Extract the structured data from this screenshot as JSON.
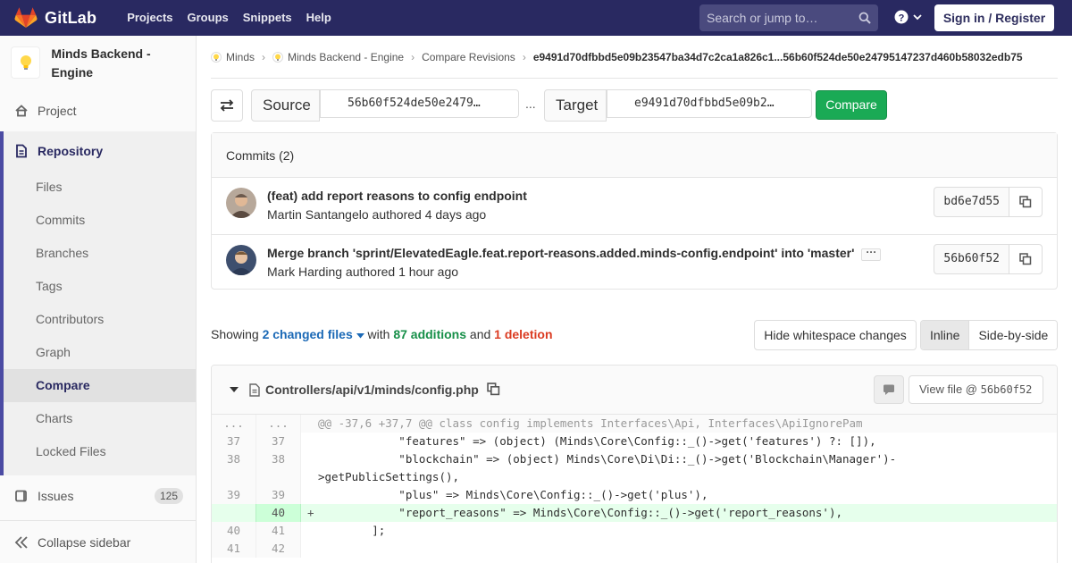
{
  "nav": {
    "brand": "GitLab",
    "links": [
      "Projects",
      "Groups",
      "Snippets",
      "Help"
    ],
    "search_placeholder": "Search or jump to…",
    "signin": "Sign in / Register"
  },
  "sidebar": {
    "project_name": "Minds Backend - Engine",
    "project": "Project",
    "repository": "Repository",
    "sub_items": [
      "Files",
      "Commits",
      "Branches",
      "Tags",
      "Contributors",
      "Graph",
      "Compare",
      "Charts",
      "Locked Files"
    ],
    "active_sub": "Compare",
    "issues": "Issues",
    "issues_count": "125",
    "collapse": "Collapse sidebar"
  },
  "breadcrumb": {
    "items": [
      "Minds",
      "Minds Backend - Engine",
      "Compare Revisions"
    ],
    "current": "e9491d70dfbbd5e09b23547ba34d7c2ca1a826c1...56b60f524de50e24795147237d460b58032edb75"
  },
  "compare": {
    "source_label": "Source",
    "source_value": "56b60f524de50e2479…",
    "ellipsis": "...",
    "target_label": "Target",
    "target_value": "e9491d70dfbbd5e09b2…",
    "button": "Compare"
  },
  "commits": {
    "header": "Commits (2)",
    "items": [
      {
        "title": "(feat) add report reasons to config endpoint",
        "author": "Martin Santangelo",
        "meta": "authored 4 days ago",
        "sha": "bd6e7d55"
      },
      {
        "title": "Merge branch 'sprint/ElevatedEagle.feat.report-reasons.added.minds-config.endpoint' into 'master'",
        "author": "Mark Harding",
        "meta": "authored 1 hour ago",
        "sha": "56b60f52"
      }
    ]
  },
  "summary": {
    "showing": "Showing",
    "changed": "2 changed files",
    "with": "with",
    "additions": "87 additions",
    "and": "and",
    "deletions": "1 deletion",
    "hide_ws": "Hide whitespace changes",
    "inline": "Inline",
    "side_by_side": "Side-by-side"
  },
  "file": {
    "path": "Controllers/api/v1/minds/config.php",
    "view_file": "View file @",
    "view_sha": "56b60f52"
  },
  "diff": [
    {
      "type": "match",
      "old": "...",
      "new": "...",
      "code": "@@ -37,6 +37,7 @@ class config implements Interfaces\\Api, Interfaces\\ApiIgnorePam"
    },
    {
      "type": "ctx",
      "old": "37",
      "new": "37",
      "code": "            \"features\" => (object) (Minds\\Core\\Config::_()->get('features') ?: []),"
    },
    {
      "type": "ctx",
      "old": "38",
      "new": "38",
      "code": "            \"blockchain\" => (object) Minds\\Core\\Di\\Di::_()->get('Blockchain\\Manager')-",
      "cont": ">getPublicSettings(),"
    },
    {
      "type": "ctx",
      "old": "39",
      "new": "39",
      "code": "            \"plus\" => Minds\\Core\\Config::_()->get('plus'),"
    },
    {
      "type": "added",
      "old": "",
      "new": "40",
      "code": "            \"report_reasons\" => Minds\\Core\\Config::_()->get('report_reasons'),"
    },
    {
      "type": "ctx",
      "old": "40",
      "new": "41",
      "code": "        ];"
    },
    {
      "type": "ctx",
      "old": "41",
      "new": "42",
      "code": ""
    }
  ]
}
